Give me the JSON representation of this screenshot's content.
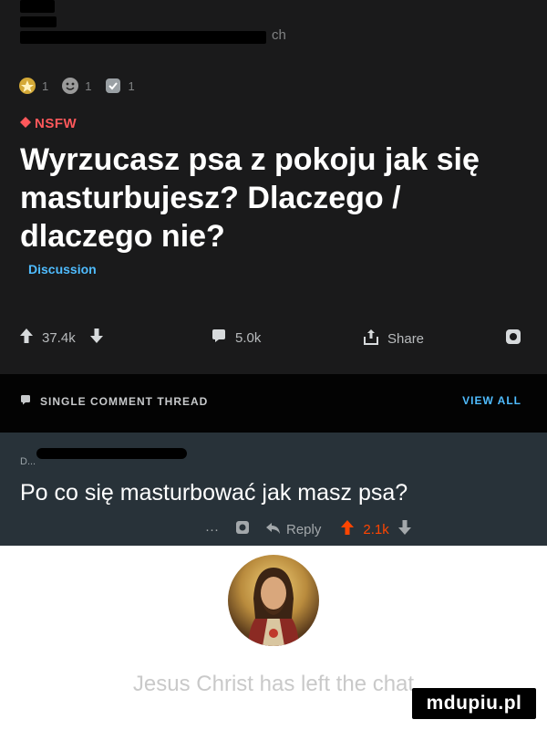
{
  "post": {
    "username_suffix": "ch",
    "awards": [
      {
        "icon": "gold-award-icon",
        "count": "1"
      },
      {
        "icon": "wholesome-award-icon",
        "count": "1"
      },
      {
        "icon": "silver-award-icon",
        "count": "1"
      }
    ],
    "nsfw_label": "NSFW",
    "title": "Wyrzucasz psa z pokoju jak się masturbujesz? Dlaczego / dlaczego nie?",
    "flair": "Discussion",
    "upvotes": "37.4k",
    "comments": "5.0k",
    "share_label": "Share"
  },
  "thread_bar": {
    "label": "SINGLE COMMENT THREAD",
    "view_all": "VIEW ALL"
  },
  "comment": {
    "author": "D...",
    "body": "Po co się masturbować jak masz psa?",
    "more": "···",
    "reply_label": "Reply",
    "score": "2.1k"
  },
  "caption": "Jesus Christ has left the chat",
  "watermark": "mdupiu.pl",
  "colors": {
    "post_bg": "#1a1a1b",
    "comment_bg": "#283239",
    "nsfw": "#ff585b",
    "flair": "#4fbcff",
    "upvote": "#ff4500"
  }
}
